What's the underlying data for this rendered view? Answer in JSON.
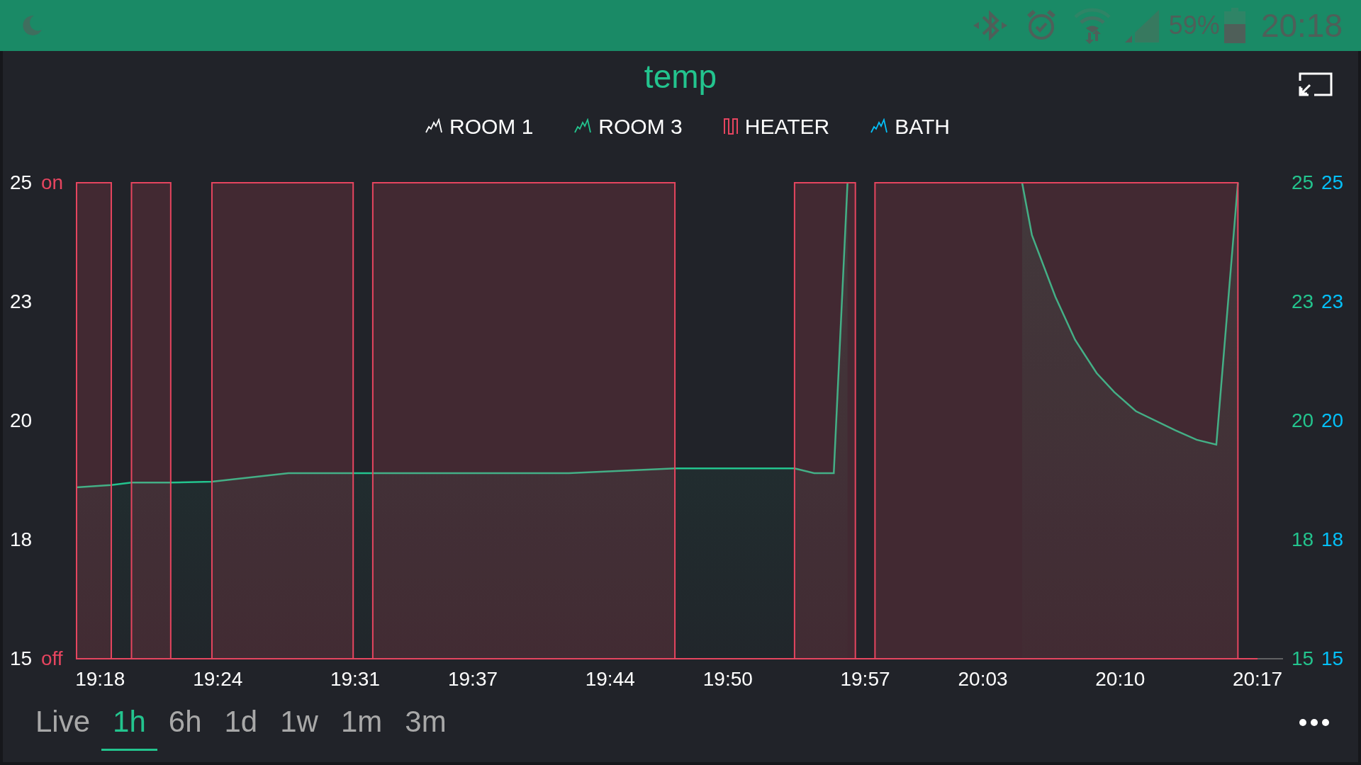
{
  "status_bar": {
    "battery": "59%",
    "time": "20:18"
  },
  "widget": {
    "title": "temp",
    "heater_axis": {
      "color": "#e6455f",
      "on": "on",
      "off": "off"
    },
    "right_axes": [
      {
        "color": "#23c48e",
        "labels": [
          "25",
          "23",
          "20",
          "18",
          "15"
        ]
      },
      {
        "color": "#04c0f8",
        "labels": [
          "25",
          "23",
          "20",
          "18",
          "15"
        ]
      }
    ],
    "legend": [
      {
        "kind": "line"
      },
      {
        "kind": "line"
      },
      {
        "kind": "step"
      },
      {
        "kind": "line"
      }
    ],
    "chart_data": {
      "type": "line",
      "xlim": [
        1156.8,
        1218.3
      ],
      "ylim": [
        15,
        25
      ],
      "x": [
        1156.8,
        1158.57,
        1159.6,
        1161.6,
        1163.7,
        1167.6,
        1170.9,
        1171.9,
        1181.9,
        1187.3,
        1193.4,
        1194.4,
        1195.4,
        1196.1,
        1196.5,
        1197.5,
        1205.0,
        1205.5,
        1206.7,
        1207.7,
        1208.8,
        1209.7,
        1210.8,
        1212.8,
        1213.9,
        1214.9,
        1216.0,
        1217.0
      ],
      "series": [
        {
          "name": "ROOM 1",
          "color": "#ffffff",
          "type": "line",
          "values": [
            null,
            null,
            null,
            null,
            null,
            null,
            null,
            null,
            null,
            null,
            null,
            null,
            null,
            null,
            null,
            null,
            null,
            null,
            null,
            null,
            null,
            null,
            null,
            null,
            null,
            null,
            null,
            null
          ]
        },
        {
          "name": "ROOM 3",
          "color": "#23c48e",
          "type": "area",
          "values": [
            18.6,
            18.65,
            18.7,
            18.7,
            18.72,
            18.9,
            18.9,
            18.9,
            18.9,
            19.0,
            19.0,
            18.9,
            18.9,
            25,
            null,
            null,
            25,
            23.9,
            22.6,
            21.7,
            21.0,
            20.6,
            20.2,
            19.8,
            19.6,
            19.5,
            25,
            null
          ]
        },
        {
          "name": "HEATER",
          "color": "#e6455f",
          "type": "area",
          "values": [
            25,
            15,
            25,
            15,
            25,
            25,
            15,
            25,
            25,
            15,
            25,
            25,
            25,
            25,
            15,
            25,
            25,
            25,
            25,
            25,
            25,
            25,
            25,
            25,
            25,
            25,
            15,
            15
          ]
        },
        {
          "name": "BATH",
          "color": "#04c0f8",
          "type": "line",
          "values": [
            null,
            null,
            null,
            null,
            null,
            null,
            null,
            null,
            null,
            null,
            null,
            null,
            null,
            null,
            null,
            null,
            null,
            null,
            null,
            null,
            null,
            null,
            null,
            null,
            null,
            null,
            null,
            null
          ]
        }
      ],
      "yticks": [
        15,
        {
          "value": 17.5,
          "label": "18"
        },
        20,
        {
          "value": 22.5,
          "label": "23"
        },
        25
      ],
      "xticks": [
        {
          "value": 1158,
          "label": "19:18"
        },
        {
          "value": 1164,
          "label": "19:24"
        },
        {
          "value": 1171,
          "label": "19:31"
        },
        {
          "value": 1177,
          "label": "19:37"
        },
        {
          "value": 1184,
          "label": "19:44"
        },
        {
          "value": 1190,
          "label": "19:50"
        },
        {
          "value": 1197,
          "label": "19:57"
        },
        {
          "value": 1203,
          "label": "20:03"
        },
        {
          "value": 1210,
          "label": "20:10"
        },
        {
          "value": 1217,
          "label": "20:17"
        }
      ]
    },
    "ranges": [
      {
        "label": "Live",
        "selected": false
      },
      {
        "label": "1h",
        "selected": true
      },
      {
        "label": "6h",
        "selected": false
      },
      {
        "label": "1d",
        "selected": false
      },
      {
        "label": "1w",
        "selected": false
      },
      {
        "label": "1m",
        "selected": false
      },
      {
        "label": "3m",
        "selected": false
      }
    ]
  }
}
